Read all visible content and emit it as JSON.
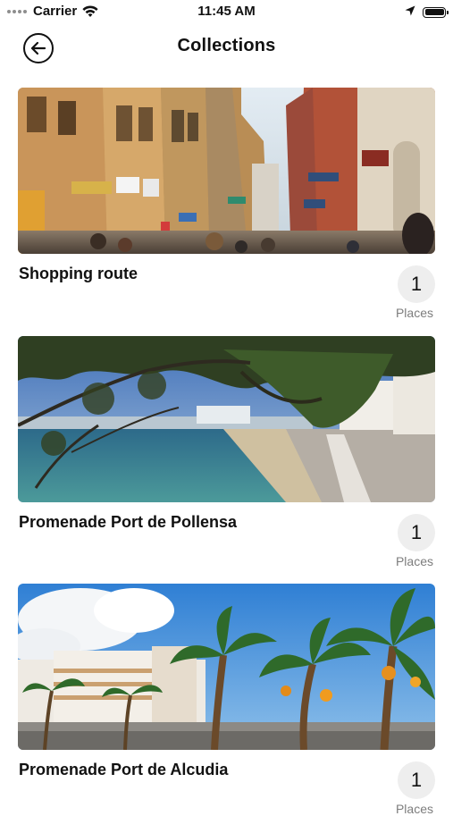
{
  "status_bar": {
    "carrier": "Carrier",
    "time": "11:45 AM"
  },
  "header": {
    "title": "Collections"
  },
  "collections": [
    {
      "title": "Shopping route",
      "count": "1",
      "count_label": "Places"
    },
    {
      "title": "Promenade Port de Pollensa",
      "count": "1",
      "count_label": "Places"
    },
    {
      "title": "Promenade Port de Alcudia",
      "count": "1",
      "count_label": "Places"
    }
  ]
}
